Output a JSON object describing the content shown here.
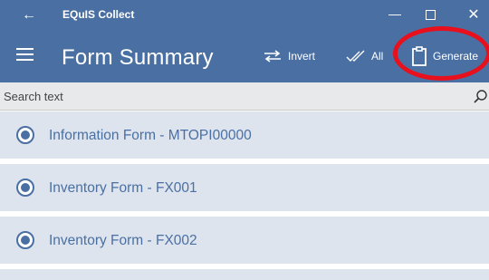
{
  "window": {
    "title": "EQuIS Collect",
    "back_glyph": "←",
    "minimize_glyph": "—",
    "close_glyph": "✕"
  },
  "header": {
    "page_title": "Form Summary",
    "buttons": {
      "invert": {
        "label": "Invert",
        "icon": "swap-arrows-icon"
      },
      "all": {
        "label": "All",
        "icon": "double-check-icon"
      },
      "generate": {
        "label": "Generate",
        "icon": "clipboard-icon"
      }
    },
    "highlight_color": "#e8101c"
  },
  "search": {
    "placeholder": "Search text"
  },
  "forms": [
    {
      "label": "Information Form - MTOPI00000"
    },
    {
      "label": "Inventory Form - FX001"
    },
    {
      "label": "Inventory Form - FX002"
    }
  ],
  "colors": {
    "accent": "#4a70a3",
    "item_background": "#dde4ee",
    "search_background": "#e8e9eb"
  }
}
